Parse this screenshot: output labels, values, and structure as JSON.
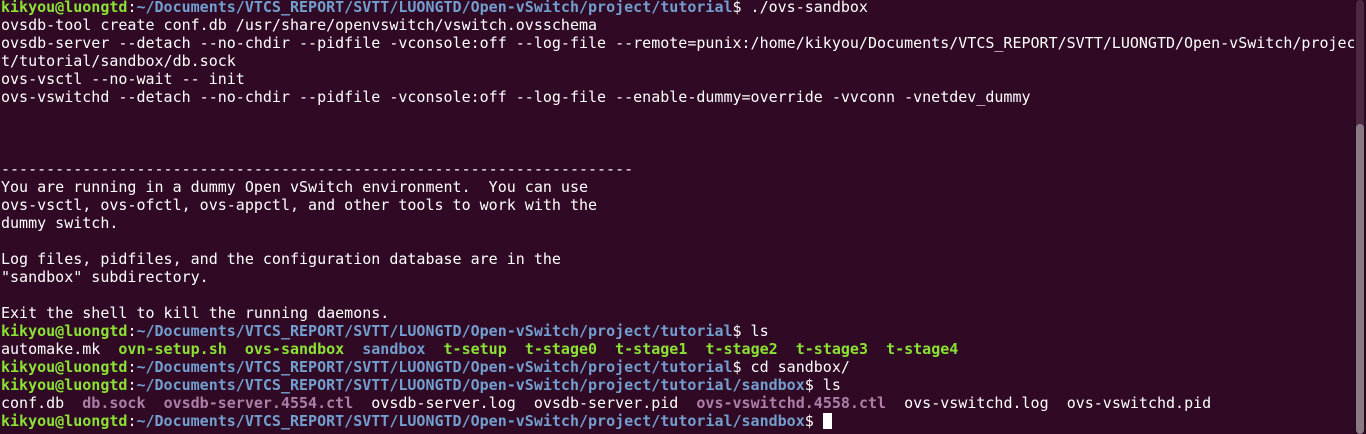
{
  "terminal": {
    "colors": {
      "background": "#300a24",
      "user_host": "#8ae234",
      "path": "#729fcf",
      "executable": "#8ae234",
      "directory": "#729fcf",
      "socket": "#ad7fa8",
      "text": "#ffffff"
    },
    "lines": [
      {
        "segments": [
          {
            "text": "kikyou@luongtd",
            "kind": "user"
          },
          {
            "text": ":",
            "kind": "plain"
          },
          {
            "text": "~/Documents/VTCS_REPORT/SVTT/LUONGTD/Open-vSwitch/project/tutorial",
            "kind": "path"
          },
          {
            "text": "$ ./ovs-sandbox",
            "kind": "plain"
          }
        ]
      },
      {
        "segments": [
          {
            "text": "ovsdb-tool create conf.db /usr/share/openvswitch/vswitch.ovsschema",
            "kind": "plain"
          }
        ]
      },
      {
        "segments": [
          {
            "text": "ovsdb-server --detach --no-chdir --pidfile -vconsole:off --log-file --remote=punix:/home/kikyou/Documents/VTCS_REPORT/SVTT/LUONGTD/Open-vSwitch/projec",
            "kind": "plain"
          }
        ]
      },
      {
        "segments": [
          {
            "text": "t/tutorial/sandbox/db.sock",
            "kind": "plain"
          }
        ]
      },
      {
        "segments": [
          {
            "text": "ovs-vsctl --no-wait -- init",
            "kind": "plain"
          }
        ]
      },
      {
        "segments": [
          {
            "text": "ovs-vswitchd --detach --no-chdir --pidfile -vconsole:off --log-file --enable-dummy=override -vvconn -vnetdev_dummy",
            "kind": "plain"
          }
        ]
      },
      {
        "segments": [
          {
            "text": "",
            "kind": "plain"
          }
        ]
      },
      {
        "segments": [
          {
            "text": "",
            "kind": "plain"
          }
        ]
      },
      {
        "segments": [
          {
            "text": "",
            "kind": "plain"
          }
        ]
      },
      {
        "segments": [
          {
            "text": "----------------------------------------------------------------------",
            "kind": "plain"
          }
        ]
      },
      {
        "segments": [
          {
            "text": "You are running in a dummy Open vSwitch environment.  You can use",
            "kind": "plain"
          }
        ]
      },
      {
        "segments": [
          {
            "text": "ovs-vsctl, ovs-ofctl, ovs-appctl, and other tools to work with the",
            "kind": "plain"
          }
        ]
      },
      {
        "segments": [
          {
            "text": "dummy switch.",
            "kind": "plain"
          }
        ]
      },
      {
        "segments": [
          {
            "text": "",
            "kind": "plain"
          }
        ]
      },
      {
        "segments": [
          {
            "text": "Log files, pidfiles, and the configuration database are in the",
            "kind": "plain"
          }
        ]
      },
      {
        "segments": [
          {
            "text": "\"sandbox\" subdirectory.",
            "kind": "plain"
          }
        ]
      },
      {
        "segments": [
          {
            "text": "",
            "kind": "plain"
          }
        ]
      },
      {
        "segments": [
          {
            "text": "Exit the shell to kill the running daemons.",
            "kind": "plain"
          }
        ]
      },
      {
        "segments": [
          {
            "text": "kikyou@luongtd",
            "kind": "user"
          },
          {
            "text": ":",
            "kind": "plain"
          },
          {
            "text": "~/Documents/VTCS_REPORT/SVTT/LUONGTD/Open-vSwitch/project/tutorial",
            "kind": "path"
          },
          {
            "text": "$ ls",
            "kind": "plain"
          }
        ]
      },
      {
        "segments": [
          {
            "text": "automake.mk",
            "kind": "plain"
          },
          {
            "text": "  ",
            "kind": "plain"
          },
          {
            "text": "ovn-setup.sh",
            "kind": "exec"
          },
          {
            "text": "  ",
            "kind": "plain"
          },
          {
            "text": "ovs-sandbox",
            "kind": "exec"
          },
          {
            "text": "  ",
            "kind": "plain"
          },
          {
            "text": "sandbox",
            "kind": "dir"
          },
          {
            "text": "  ",
            "kind": "plain"
          },
          {
            "text": "t-setup",
            "kind": "exec"
          },
          {
            "text": "  ",
            "kind": "plain"
          },
          {
            "text": "t-stage0",
            "kind": "exec"
          },
          {
            "text": "  ",
            "kind": "plain"
          },
          {
            "text": "t-stage1",
            "kind": "exec"
          },
          {
            "text": "  ",
            "kind": "plain"
          },
          {
            "text": "t-stage2",
            "kind": "exec"
          },
          {
            "text": "  ",
            "kind": "plain"
          },
          {
            "text": "t-stage3",
            "kind": "exec"
          },
          {
            "text": "  ",
            "kind": "plain"
          },
          {
            "text": "t-stage4",
            "kind": "exec"
          }
        ]
      },
      {
        "segments": [
          {
            "text": "kikyou@luongtd",
            "kind": "user"
          },
          {
            "text": ":",
            "kind": "plain"
          },
          {
            "text": "~/Documents/VTCS_REPORT/SVTT/LUONGTD/Open-vSwitch/project/tutorial",
            "kind": "path"
          },
          {
            "text": "$ cd sandbox/",
            "kind": "plain"
          }
        ]
      },
      {
        "segments": [
          {
            "text": "kikyou@luongtd",
            "kind": "user"
          },
          {
            "text": ":",
            "kind": "plain"
          },
          {
            "text": "~/Documents/VTCS_REPORT/SVTT/LUONGTD/Open-vSwitch/project/tutorial/sandbox",
            "kind": "path"
          },
          {
            "text": "$ ls",
            "kind": "plain"
          }
        ]
      },
      {
        "segments": [
          {
            "text": "conf.db",
            "kind": "plain"
          },
          {
            "text": "  ",
            "kind": "plain"
          },
          {
            "text": "db.sock",
            "kind": "sock"
          },
          {
            "text": "  ",
            "kind": "plain"
          },
          {
            "text": "ovsdb-server.4554.ctl",
            "kind": "sock"
          },
          {
            "text": "  ",
            "kind": "plain"
          },
          {
            "text": "ovsdb-server.log",
            "kind": "plain"
          },
          {
            "text": "  ",
            "kind": "plain"
          },
          {
            "text": "ovsdb-server.pid",
            "kind": "plain"
          },
          {
            "text": "  ",
            "kind": "plain"
          },
          {
            "text": "ovs-vswitchd.4558.ctl",
            "kind": "sock"
          },
          {
            "text": "  ",
            "kind": "plain"
          },
          {
            "text": "ovs-vswitchd.log",
            "kind": "plain"
          },
          {
            "text": "  ",
            "kind": "plain"
          },
          {
            "text": "ovs-vswitchd.pid",
            "kind": "plain"
          }
        ]
      },
      {
        "segments": [
          {
            "text": "kikyou@luongtd",
            "kind": "user"
          },
          {
            "text": ":",
            "kind": "plain"
          },
          {
            "text": "~/Documents/VTCS_REPORT/SVTT/LUONGTD/Open-vSwitch/project/tutorial/sandbox",
            "kind": "path"
          },
          {
            "text": "$ ",
            "kind": "plain"
          }
        ],
        "cursor": true
      }
    ]
  }
}
